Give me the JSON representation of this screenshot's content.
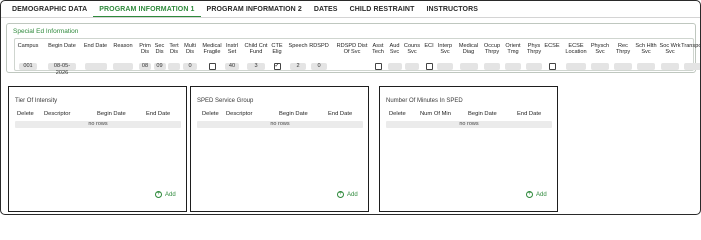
{
  "tabs": [
    "DEMOGRAPHIC DATA",
    "PROGRAM INFORMATION 1",
    "PROGRAM INFORMATION 2",
    "DATES",
    "CHILD RESTRAINT",
    "INSTRUCTORS"
  ],
  "active_tab": "PROGRAM INFORMATION 1",
  "special_ed": {
    "title": "Special Ed Information",
    "columns": [
      {
        "label": "Campus",
        "value": "001"
      },
      {
        "label": "Begin Date",
        "value": "08-05-2026"
      },
      {
        "label": "End Date",
        "value": ""
      },
      {
        "label": "Reason",
        "value": ""
      },
      {
        "label": "Prim Dis",
        "value": "08"
      },
      {
        "label": "Sec Dis",
        "value": "09"
      },
      {
        "label": "Tert Dis",
        "value": ""
      },
      {
        "label": "Multi Dis",
        "value": "0"
      },
      {
        "label": "Medical Fragile",
        "checked": false
      },
      {
        "label": "Instrl Set",
        "value": "40"
      },
      {
        "label": "Child Cnt Fund",
        "value": "3"
      },
      {
        "label": "CTE Elig",
        "checked": true
      },
      {
        "label": "Speech",
        "value": "2"
      },
      {
        "label": "RDSPD",
        "value": "0"
      },
      {
        "label": "RDSPD Dist Of Svc",
        "value": ""
      },
      {
        "label": "Asst Tech",
        "checked": false
      },
      {
        "label": "Aud Svc",
        "value": ""
      },
      {
        "label": "Couns Svc",
        "value": ""
      },
      {
        "label": "ECI",
        "checked": false
      },
      {
        "label": "Interp Svc",
        "value": ""
      },
      {
        "label": "Medical Diag",
        "value": ""
      },
      {
        "label": "Occup Thrpy",
        "value": ""
      },
      {
        "label": "Orient Tmg",
        "value": ""
      },
      {
        "label": "Phys Thrpy",
        "value": ""
      },
      {
        "label": "ECSE",
        "checked": false
      },
      {
        "label": "ECSE Location",
        "value": ""
      },
      {
        "label": "Physch Svc",
        "value": ""
      },
      {
        "label": "Rec Thrpy",
        "value": ""
      },
      {
        "label": "Sch Hlth Svc",
        "value": ""
      },
      {
        "label": "Soc Wrk Svc",
        "value": ""
      },
      {
        "label": "Transport",
        "value": ""
      }
    ]
  },
  "panels": [
    {
      "title": "Tier Of Intensity",
      "headers": [
        "Delete",
        "Descriptor",
        "Begin Date",
        "End Date"
      ],
      "empty": "no rows",
      "add_label": "Add"
    },
    {
      "title": "SPED Service Group",
      "headers": [
        "Delete",
        "Descriptor",
        "Begin Date",
        "End Date"
      ],
      "empty": "no rows",
      "add_label": "Add"
    },
    {
      "title": "Number Of Minutes In SPED",
      "headers": [
        "Delete",
        "Num Of Min",
        "Begin Date",
        "End Date"
      ],
      "empty": "no rows",
      "add_label": "Add"
    }
  ]
}
